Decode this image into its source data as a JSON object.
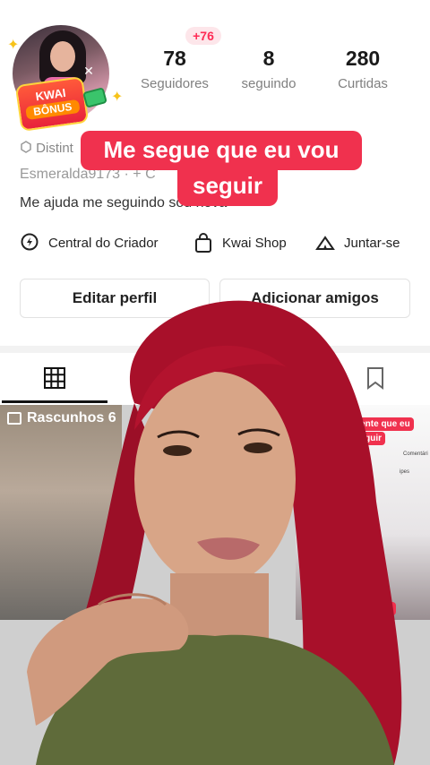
{
  "profile": {
    "followers_new_badge": "+76",
    "stats": [
      {
        "value": "78",
        "label": "Seguidores"
      },
      {
        "value": "8",
        "label": "seguindo"
      },
      {
        "value": "280",
        "label": "Curtidas"
      }
    ],
    "avatar_badge": {
      "line1": "KWAI",
      "line2": "BÔNUS"
    },
    "distinction_text": "Distint",
    "username": "Esmeralda9173 · + C",
    "bio": "Me ajuda me seguindo sou nova"
  },
  "caption": {
    "line1": "Me segue que eu vou",
    "line2": "seguir"
  },
  "links": [
    {
      "label": "Central do Criador",
      "icon": "bolt-pin-icon"
    },
    {
      "label": "Kwai Shop",
      "icon": "shopping-bag-icon"
    },
    {
      "label": "Juntar-se",
      "icon": "group-tent-icon"
    }
  ],
  "buttons": {
    "edit_profile": "Editar perfil",
    "add_friends": "Adicionar amigos"
  },
  "tabs": {
    "active": "grid-icon",
    "icons": [
      "grid-icon",
      "bookmark-icon"
    ]
  },
  "grid": {
    "drafts_label": "Rascunhos 6",
    "cell3_tag_line1": "gente que eu",
    "cell3_tag_line2": "seguir",
    "cell3_side_1": "Comentári",
    "cell3_side_2": "ipes",
    "cell3_tag_bottom": "em"
  },
  "colors": {
    "accent": "#f0314e",
    "badge_text": "#fe2c55",
    "hair": "#a8102a",
    "shirt": "#5f6b3a"
  }
}
